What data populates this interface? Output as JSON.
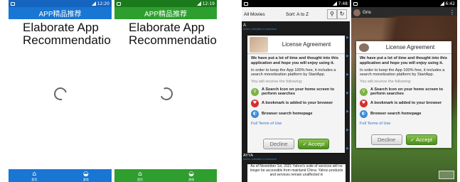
{
  "phone1": {
    "status_time": "12:20",
    "appbar_title": "APP精品推荐",
    "title": "Elaborate App Recommendation",
    "nav": [
      {
        "icon": "home-icon",
        "label": "首页"
      },
      {
        "icon": "gamepad-icon",
        "label": "游戏"
      }
    ],
    "color": "#1976d2"
  },
  "phone2": {
    "status_time": "12:19",
    "appbar_title": "APP精品推荐",
    "title": "Elaborate App Recommendation",
    "nav": [
      {
        "icon": "home-icon",
        "label": "首页"
      },
      {
        "icon": "gamepad-icon",
        "label": "游戏"
      }
    ],
    "color": "#2e9e2e"
  },
  "phone3": {
    "status_time": "7:48",
    "toolbar": {
      "movies_dropdown": "All Movies",
      "sort_dropdown": "Sort: A to Z"
    },
    "list_top": {
      "letter": "A",
      "sub": "Action, Animation & Adventure"
    },
    "list_bottom": {
      "title": "AYYA",
      "sub": "Action, Animation & Adventure"
    },
    "bottom_text": "As of November 1st, 2021 Yahoo's suite of services will no longer be accessible from mainland China. Yahoo products and services remain unaffected in"
  },
  "phone4": {
    "status_time": "6:42",
    "app_title": "Gris"
  },
  "dialog": {
    "title": "License Agreement",
    "intro": "We have put a lot of time and thought into this application and hope you will enjoy using it.",
    "free_text": "In order to keep the App 100% free, it includes a search monetization platform by StartApp.",
    "receive": "You will receive the following:",
    "items": [
      {
        "icon": "search-icon",
        "color": "#7cb342",
        "text": "A Search Icon on your home screen to perform searches"
      },
      {
        "icon": "heart-icon",
        "color": "#d32f2f",
        "text": "A bookmark is added to your browser"
      },
      {
        "icon": "globe-icon",
        "color": "#3a8bd6",
        "text": "Browser search homepage"
      }
    ],
    "terms": "Full Terms of Use",
    "decline": "Decline",
    "accept": "Accept"
  }
}
